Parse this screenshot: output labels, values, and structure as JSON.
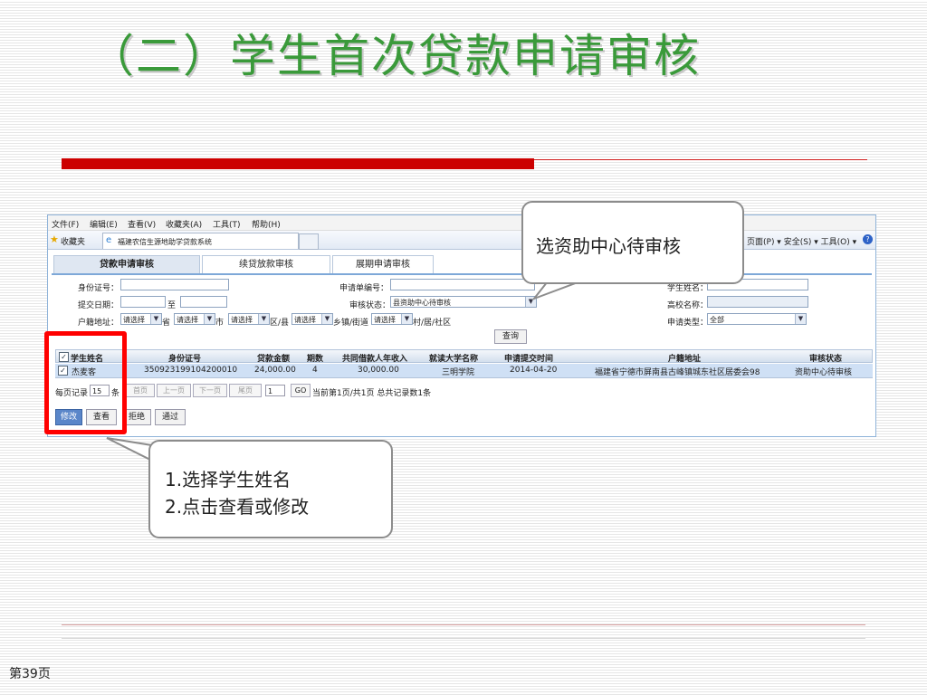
{
  "slide": {
    "title": "（二）学生首次贷款申请审核",
    "page_number": "第39页"
  },
  "browser": {
    "menu": [
      "文件(F)",
      "编辑(E)",
      "查看(V)",
      "收藏夹(A)",
      "工具(T)",
      "帮助(H)"
    ],
    "favorites_label": "收藏夹",
    "tab_title": "福建农信生源地助学贷款系统",
    "right_tools": "页面(P) ▾  安全(S) ▾  工具(O) ▾",
    "icons": {
      "favorites": "star-icon",
      "tab": "ie-icon",
      "help": "help-icon"
    }
  },
  "app": {
    "tabs": [
      "贷款申请审核",
      "续贷放款审核",
      "展期申请审核"
    ],
    "form": {
      "id_card_label": "身份证号：",
      "apply_no_label": "申请单编号：",
      "student_name_label": "学生姓名：",
      "submit_date_label": "提交日期：",
      "to_label": "至",
      "audit_status_label": "审核状态：",
      "audit_status_value": "县资助中心待审核",
      "college_label": "高校名称：",
      "hukou_label": "户籍地址：",
      "select_placeholder": "请选择",
      "province": "省",
      "city": "市",
      "district": "区/县",
      "town": "乡镇/街道",
      "village": "村/居/社区",
      "apply_type_label": "申请类型：",
      "apply_type_value": "全部",
      "query_button": "查询"
    },
    "table": {
      "headers": [
        "学生姓名",
        "身份证号",
        "贷款金额",
        "期数",
        "共同借款人年收入",
        "就读大学名称",
        "申请提交时间",
        "户籍地址",
        "审核状态"
      ],
      "rows": [
        [
          "杰麦客",
          "350923199104200010",
          "24,000.00",
          "4",
          "30,000.00",
          "三明学院",
          "2014-04-20",
          "福建省宁德市屏南县古峰镇城东社区居委会98",
          "资助中心待审核"
        ]
      ]
    },
    "pager": {
      "per_page_label": "每页记录",
      "per_page_value": "15",
      "unit": "条",
      "first": "首页",
      "prev": "上一页",
      "next": "下一页",
      "last": "尾页",
      "page_input": "1",
      "go": "GO",
      "info": "当前第1页/共1页 总共记录数1条"
    },
    "actions": {
      "edit": "修改",
      "view": "查看",
      "reject": "拒绝",
      "approve": "通过"
    }
  },
  "callouts": {
    "top": "选资助中心待审核",
    "bottom_line1": "1.选择学生姓名",
    "bottom_line2": "2.点击查看或修改"
  },
  "colors": {
    "title_green": "#3a9a3a",
    "accent_red": "#cc0000",
    "highlight_red": "#ff0000"
  }
}
